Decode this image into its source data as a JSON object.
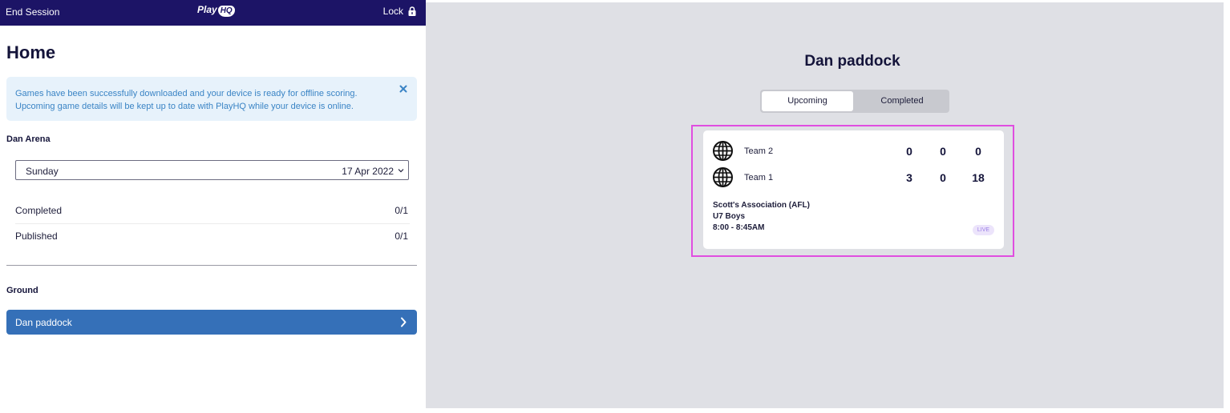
{
  "topbar": {
    "end_session": "End Session",
    "logo_text": "Play",
    "logo_badge": "HQ",
    "lock_label": "Lock",
    "lock_icon": "padlock-icon",
    "bg_color": "#1c1466"
  },
  "home": {
    "title": "Home",
    "notice": "Games have been successfully downloaded and your device is ready for offline scoring. Upcoming game details will be kept up to date with PlayHQ while your device is online.",
    "notice_close_icon": "close-icon"
  },
  "arena": {
    "label": "Dan Arena",
    "day_select": {
      "day": "Sunday",
      "date": "17 Apr 2022",
      "icon": "chevron-down-icon"
    },
    "stats": [
      {
        "label": "Completed",
        "value": "0/1"
      },
      {
        "label": "Published",
        "value": "0/1"
      }
    ]
  },
  "ground": {
    "label": "Ground",
    "items": [
      {
        "name": "Dan paddock",
        "icon": "chevron-right-icon"
      }
    ],
    "button_color": "#3570b8"
  },
  "main": {
    "title": "Dan paddock",
    "tabs": [
      {
        "label": "Upcoming",
        "active": true
      },
      {
        "label": "Completed",
        "active": false
      }
    ],
    "game": {
      "teams": [
        {
          "name": "Team 2",
          "icon": "globe-icon",
          "scores": [
            "0",
            "0",
            "0"
          ]
        },
        {
          "name": "Team 1",
          "icon": "globe-icon",
          "scores": [
            "3",
            "0",
            "18"
          ]
        }
      ],
      "association": "Scott's Association (AFL)",
      "grade": "U7 Boys",
      "time": "8:00 - 8:45AM",
      "status": "LIVE",
      "highlight_color": "#e04ee0"
    }
  }
}
